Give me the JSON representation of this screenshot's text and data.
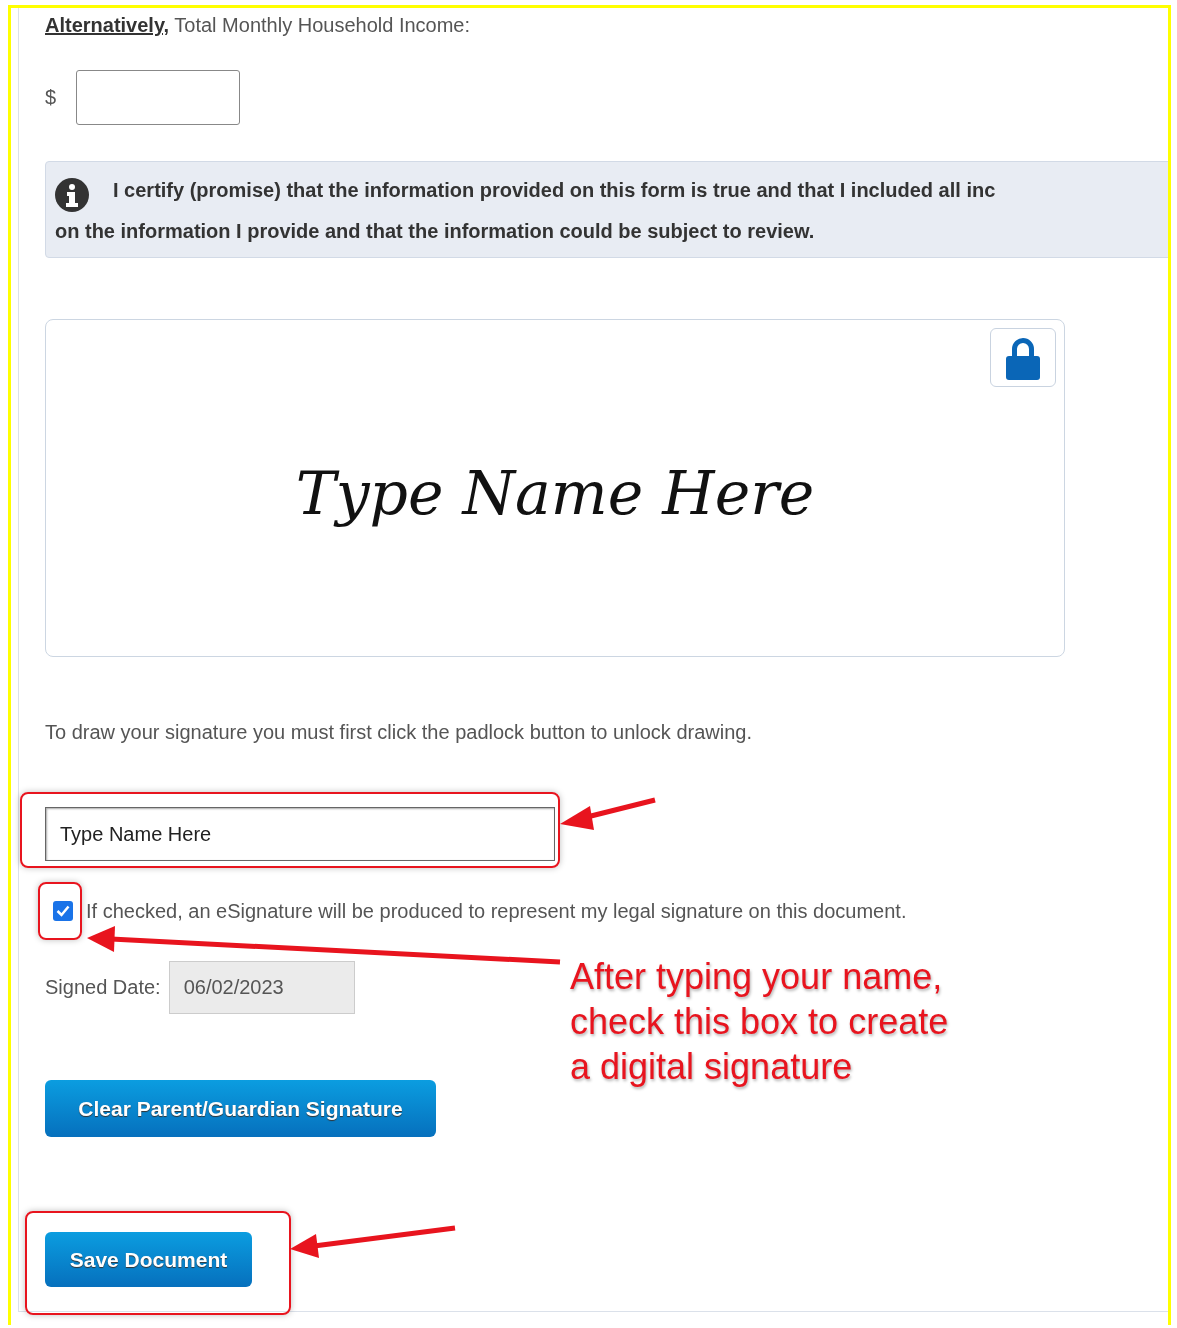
{
  "income": {
    "label_bold": "Alternatively,",
    "label_rest": " Total Monthly Household Income:",
    "currency": "$"
  },
  "certification": {
    "lines": [
      "I certify (promise) that the information provided on this form is true and that I included all inc",
      "on the information I provide and that the information could be subject to review."
    ]
  },
  "signature_pad": {
    "preview_text": "Type Name Here",
    "locked": true
  },
  "instruction": "To draw your signature you must first click the padlock button to unlock drawing.",
  "name_field": {
    "value": "Type Name Here"
  },
  "esignature_checkbox": {
    "label": "If checked, an eSignature will be produced to represent my legal signature on this document.",
    "checked": true
  },
  "signed_date": {
    "label": "Signed Date:",
    "value": "06/02/2023",
    "disabled": true
  },
  "buttons": [
    {
      "label": "Clear Parent/Guardian Signature"
    },
    {
      "label": "Save Document"
    }
  ],
  "annotation": {
    "text": "After typing your name,\ncheck this box to create\na digital signature"
  }
}
